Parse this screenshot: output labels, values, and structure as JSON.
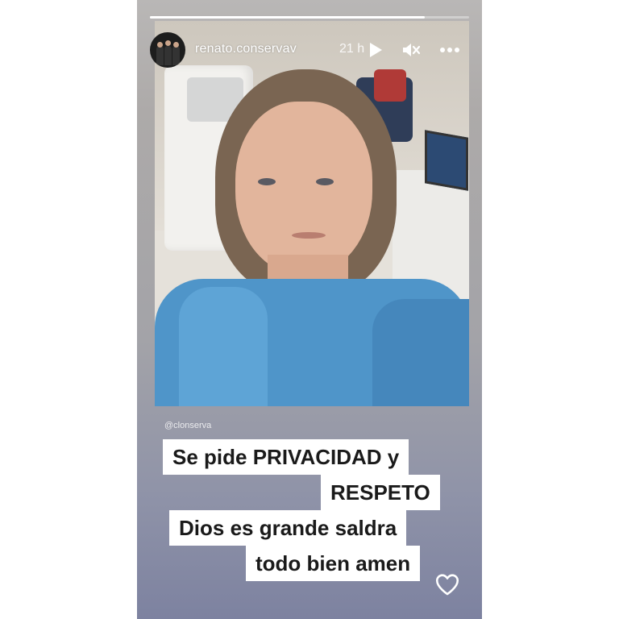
{
  "story": {
    "progress_fraction": 0.86,
    "username": "renato.conservav",
    "time_ago": "21 h",
    "mention": "@clonserva",
    "caption_lines": [
      "Se pide PRIVACIDAD y",
      "RESPETO",
      "Dios es grande saldra",
      "todo bien amen"
    ]
  },
  "icons": {
    "play": "play-icon",
    "mute": "speaker-muted-icon",
    "more": "more-icon",
    "like": "heart-icon"
  }
}
